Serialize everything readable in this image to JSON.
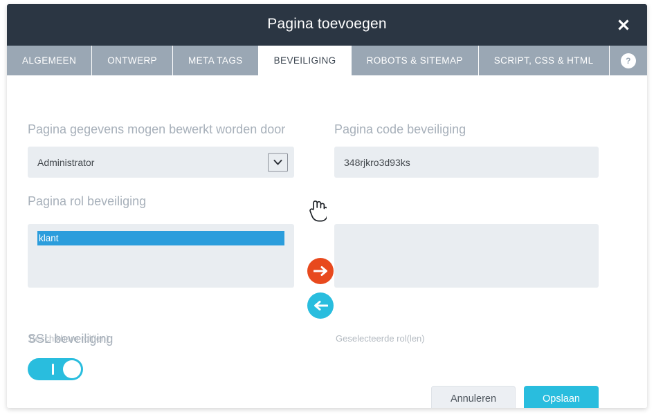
{
  "window": {
    "title": "Pagina toevoegen",
    "close_label": "×",
    "close_icon": "close-icon"
  },
  "tabs": [
    {
      "label": "ALGEMEEN",
      "active": false
    },
    {
      "label": "ONTWERP",
      "active": false
    },
    {
      "label": "META TAGS",
      "active": false
    },
    {
      "label": "BEVEILIGING",
      "active": true
    },
    {
      "label": "ROBOTS & SITEMAP",
      "active": false
    },
    {
      "label": "SCRIPT, CSS & HTML",
      "active": false
    }
  ],
  "help": {
    "label": "?",
    "icon": "question-mark-icon"
  },
  "form": {
    "edit_rights": {
      "label": "Pagina gegevens mogen bewerkt worden door",
      "value": "Administrator",
      "arrow_icon": "chevron-down-icon"
    },
    "page_code": {
      "label": "Pagina code beveiliging",
      "value": "348rjkro3d93ks",
      "placeholder": ""
    },
    "role_security": {
      "label": "Pagina rol beveiliging",
      "available_caption": "Beschikbare rol(len)",
      "selected_caption": "Geselecteerde rol(len)",
      "available_roles": [
        "klant"
      ],
      "selected_roles": [],
      "selected_index": 0,
      "add_button_icon": "arrow-right-icon",
      "remove_button_icon": "arrow-left-icon"
    },
    "ssl": {
      "label": "SSL beveiliging",
      "state": "on"
    }
  },
  "footer": {
    "cancel_label": "Annuleren",
    "save_label": "Opslaan"
  },
  "colors": {
    "header_bg": "#2b3643",
    "tabbar_bg": "#9aa7b4",
    "accent_cyan": "#29bdde",
    "accent_orange": "#e8491d",
    "select_blue": "#2b9ddc",
    "input_bg": "#e9edf1",
    "label_gray": "#a7b0ba"
  }
}
